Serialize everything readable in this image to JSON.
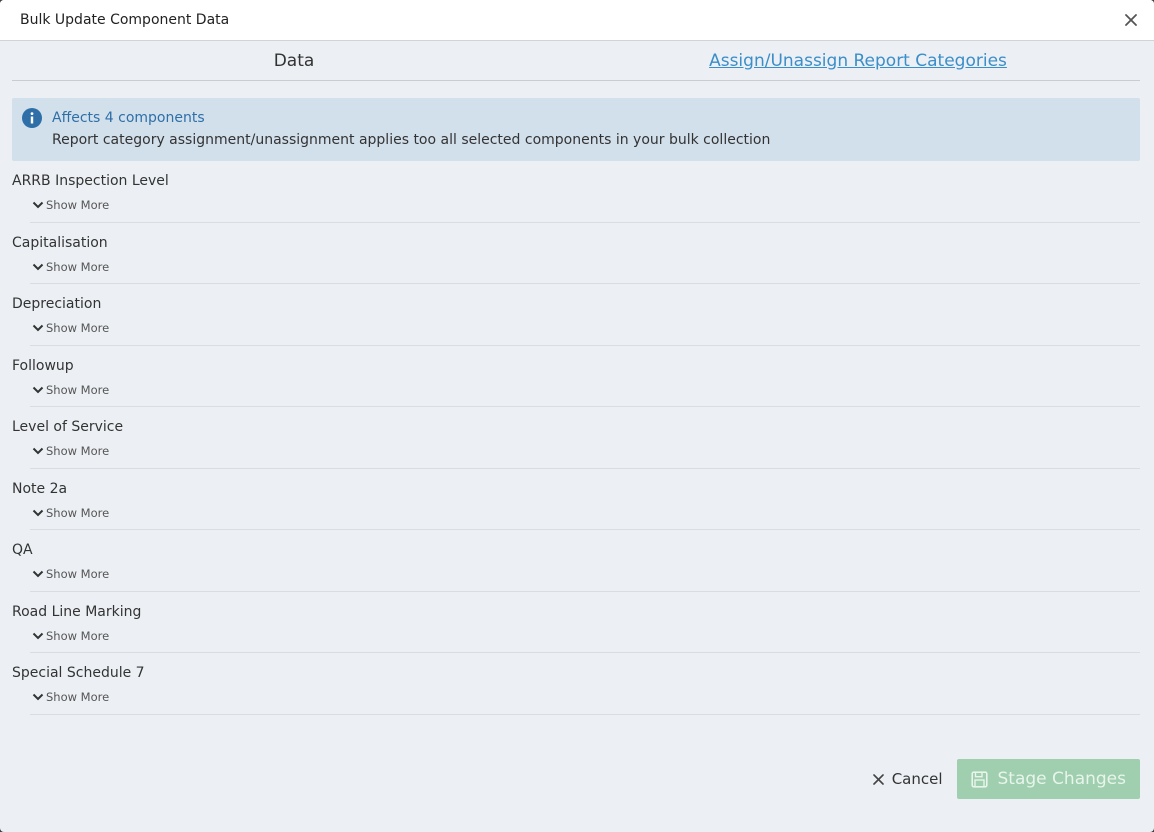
{
  "modal": {
    "title": "Bulk Update Component Data",
    "close_icon": "close-icon"
  },
  "tabs": [
    {
      "label": "Data",
      "active": false
    },
    {
      "label": "Assign/Unassign Report Categories",
      "active": true
    }
  ],
  "info": {
    "icon": "info-icon",
    "title": "Affects 4 components",
    "text": "Report category assignment/unassignment applies too all selected components in your bulk collection"
  },
  "categories": [
    {
      "title": "ARRB Inspection Level",
      "show_more": "Show More"
    },
    {
      "title": "Capitalisation",
      "show_more": "Show More"
    },
    {
      "title": "Depreciation",
      "show_more": "Show More"
    },
    {
      "title": "Followup",
      "show_more": "Show More"
    },
    {
      "title": "Level of Service",
      "show_more": "Show More"
    },
    {
      "title": "Note 2a",
      "show_more": "Show More"
    },
    {
      "title": "QA",
      "show_more": "Show More"
    },
    {
      "title": "Road Line Marking",
      "show_more": "Show More"
    },
    {
      "title": "Special Schedule 7",
      "show_more": "Show More"
    }
  ],
  "footer": {
    "cancel_label": "Cancel",
    "stage_label": "Stage Changes"
  },
  "colors": {
    "accent": "#3a8ec9",
    "info_bg": "#d2e0ec",
    "stage_btn": "#9fcfae"
  }
}
